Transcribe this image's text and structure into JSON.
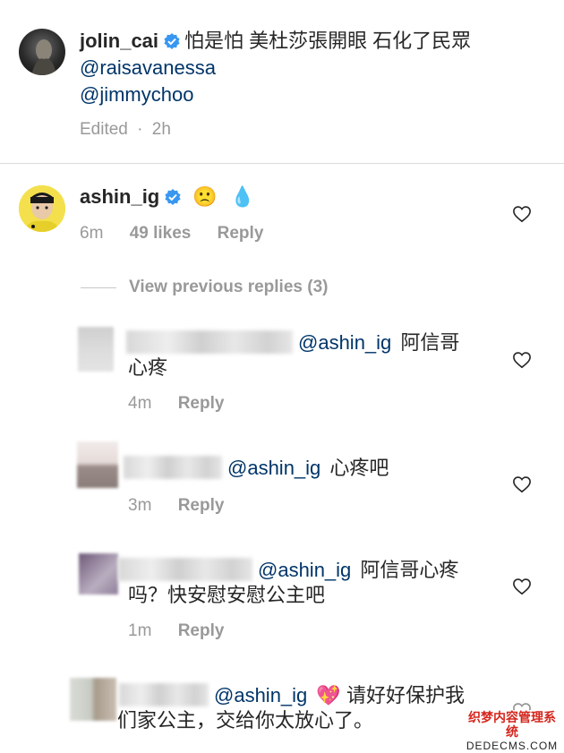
{
  "caption": {
    "username": "jolin_cai",
    "text": "怕是怕 美杜莎張開眼 石化了民眾",
    "mention1": "@raisavanessa",
    "mention2": "@jimmychoo",
    "edited": "Edited",
    "separator": "·",
    "time": "2h"
  },
  "comment": {
    "username": "ashin_ig",
    "emoji1": "🙁",
    "emoji2": "💧",
    "time": "6m",
    "likes": "49 likes",
    "reply": "Reply"
  },
  "view_previous": "View previous replies (3)",
  "replies": [
    {
      "mention": "@ashin_ig",
      "text_line1": "阿信哥",
      "text_line2": "心疼",
      "time": "4m",
      "reply": "Reply"
    },
    {
      "mention": "@ashin_ig",
      "text_line1": "心疼吧",
      "time": "3m",
      "reply": "Reply"
    },
    {
      "mention": "@ashin_ig",
      "text_line1": "阿信哥心疼",
      "text_line2": "吗？快安慰安慰公主吧",
      "time": "1m",
      "reply": "Reply"
    },
    {
      "mention": "@ashin_ig",
      "emoji": "💖",
      "text_line1": "请好好保护我",
      "text_line2": "们家公主，交给你太放心了。"
    }
  ],
  "watermark": {
    "line1": "织梦内容管理系统",
    "line2": "DEDECMS.COM"
  },
  "colors": {
    "mention": "#003569",
    "meta": "#999999",
    "verified": "#3897f0"
  }
}
